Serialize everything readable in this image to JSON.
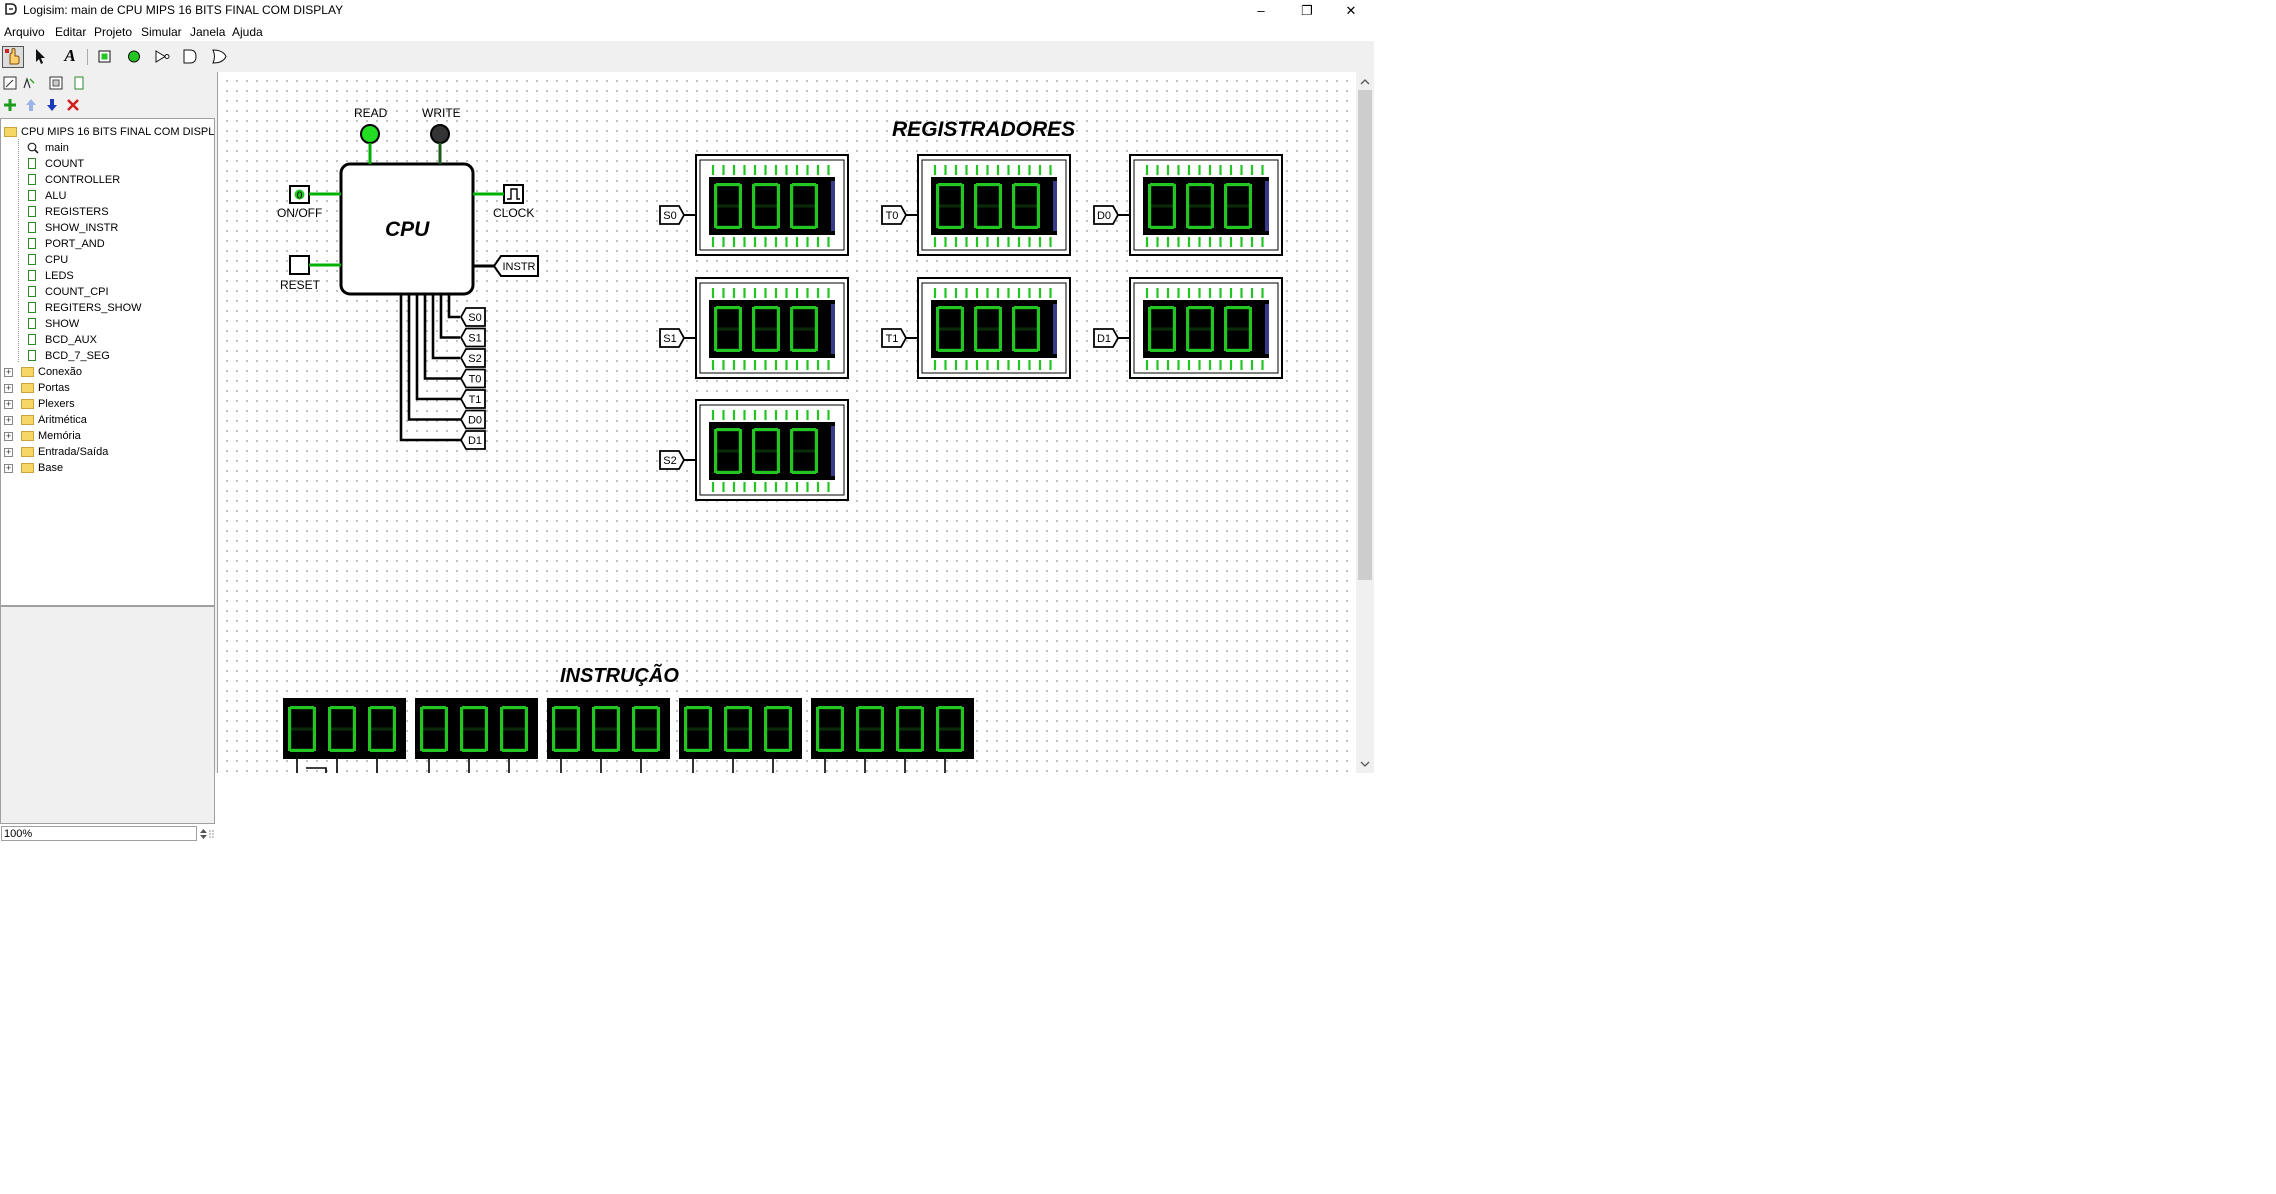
{
  "window": {
    "title": "Logisim: main de CPU MIPS 16 BITS FINAL COM DISPLAY",
    "minimize": "–",
    "restore": "❐",
    "close": "✕"
  },
  "menu": [
    "Arquivo",
    "Editar",
    "Projeto",
    "Simular",
    "Janela",
    "Ajuda"
  ],
  "toolbar": {
    "icons": [
      "hand-poke-icon",
      "select-arrow-icon",
      "text-tool-icon",
      "input-pin-icon",
      "output-pin-icon",
      "not-gate-icon",
      "and-gate-icon",
      "or-gate-icon"
    ],
    "text_tool": "A"
  },
  "explorer": {
    "project": "CPU MIPS 16 BITS FINAL COM DISPLAY",
    "circuits": [
      "main",
      "COUNT",
      "CONTROLLER",
      "ALU",
      "REGISTERS",
      "SHOW_INSTR",
      "PORT_AND",
      "CPU",
      "LEDS",
      "COUNT_CPI",
      "REGITERS_SHOW",
      "SHOW",
      "BCD_AUX",
      "BCD_7_SEG"
    ],
    "libraries": [
      "Conexão",
      "Portas",
      "Plexers",
      "Aritmética",
      "Memória",
      "Entrada/Saída",
      "Base"
    ]
  },
  "zoom": "100%",
  "circuit": {
    "cpu_label": "CPU",
    "read_label": "READ",
    "write_label": "WRITE",
    "onoff_label": "ON/OFF",
    "onoff_value": "0",
    "reset_label": "RESET",
    "clock_label": "CLOCK",
    "instr_label": "INSTR",
    "outputs": [
      "S0",
      "S1",
      "S2",
      "T0",
      "T1",
      "D0",
      "D1"
    ],
    "read_led_color": "#22dd22",
    "write_led_color": "#333333"
  },
  "registradores": {
    "heading": "REGISTRADORES",
    "registers": [
      {
        "label": "S0",
        "digits": "000"
      },
      {
        "label": "T0",
        "digits": "000"
      },
      {
        "label": "D0",
        "digits": "000"
      },
      {
        "label": "S1",
        "digits": "000"
      },
      {
        "label": "T1",
        "digits": "000"
      },
      {
        "label": "D1",
        "digits": "000"
      },
      {
        "label": "S2",
        "digits": "000"
      }
    ]
  },
  "instrucao": {
    "heading": "INSTRUÇÃO",
    "groups": [
      "000",
      "000",
      "000",
      "000",
      "0000"
    ]
  },
  "colors": {
    "segment_on": "#22c522",
    "display_bg": "#000000",
    "wire_on": "#00b000"
  }
}
